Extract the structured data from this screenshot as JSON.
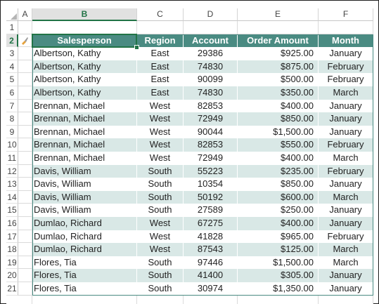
{
  "columns": [
    "A",
    "B",
    "C",
    "D",
    "E",
    "F"
  ],
  "active_column": "B",
  "active_row": "2",
  "header": [
    "Salesperson",
    "Region",
    "Account",
    "Order Amount",
    "Month"
  ],
  "row_numbers": [
    "1",
    "2",
    "3",
    "4",
    "5",
    "6",
    "7",
    "8",
    "9",
    "10",
    "11",
    "12",
    "13",
    "14",
    "15",
    "16",
    "17",
    "18",
    "19",
    "20",
    "21"
  ],
  "rows": [
    [
      "Albertson, Kathy",
      "East",
      "29386",
      "$925.00",
      "January"
    ],
    [
      "Albertson, Kathy",
      "East",
      "74830",
      "$875.00",
      "February"
    ],
    [
      "Albertson, Kathy",
      "East",
      "90099",
      "$500.00",
      "February"
    ],
    [
      "Albertson, Kathy",
      "East",
      "74830",
      "$350.00",
      "March"
    ],
    [
      "Brennan, Michael",
      "West",
      "82853",
      "$400.00",
      "January"
    ],
    [
      "Brennan, Michael",
      "West",
      "72949",
      "$850.00",
      "January"
    ],
    [
      "Brennan, Michael",
      "West",
      "90044",
      "$1,500.00",
      "January"
    ],
    [
      "Brennan, Michael",
      "West",
      "82853",
      "$550.00",
      "February"
    ],
    [
      "Brennan, Michael",
      "West",
      "72949",
      "$400.00",
      "March"
    ],
    [
      "Davis, William",
      "South",
      "55223",
      "$235.00",
      "February"
    ],
    [
      "Davis, William",
      "South",
      "10354",
      "$850.00",
      "January"
    ],
    [
      "Davis, William",
      "South",
      "50192",
      "$600.00",
      "March"
    ],
    [
      "Davis, William",
      "South",
      "27589",
      "$250.00",
      "January"
    ],
    [
      "Dumlao, Richard",
      "West",
      "67275",
      "$400.00",
      "January"
    ],
    [
      "Dumlao, Richard",
      "West",
      "41828",
      "$965.00",
      "February"
    ],
    [
      "Dumlao, Richard",
      "West",
      "87543",
      "$125.00",
      "March"
    ],
    [
      "Flores, Tia",
      "South",
      "97446",
      "$1,500.00",
      "March"
    ],
    [
      "Flores, Tia",
      "South",
      "41400",
      "$305.00",
      "January"
    ],
    [
      "Flores, Tia",
      "South",
      "30974",
      "$1,350.00",
      "January"
    ]
  ],
  "colors": {
    "header_bg": "#4a8b82",
    "band_bg": "#d9e8e6",
    "selection": "#217346"
  },
  "icons": {
    "quick_analysis": "paintbrush-icon"
  }
}
